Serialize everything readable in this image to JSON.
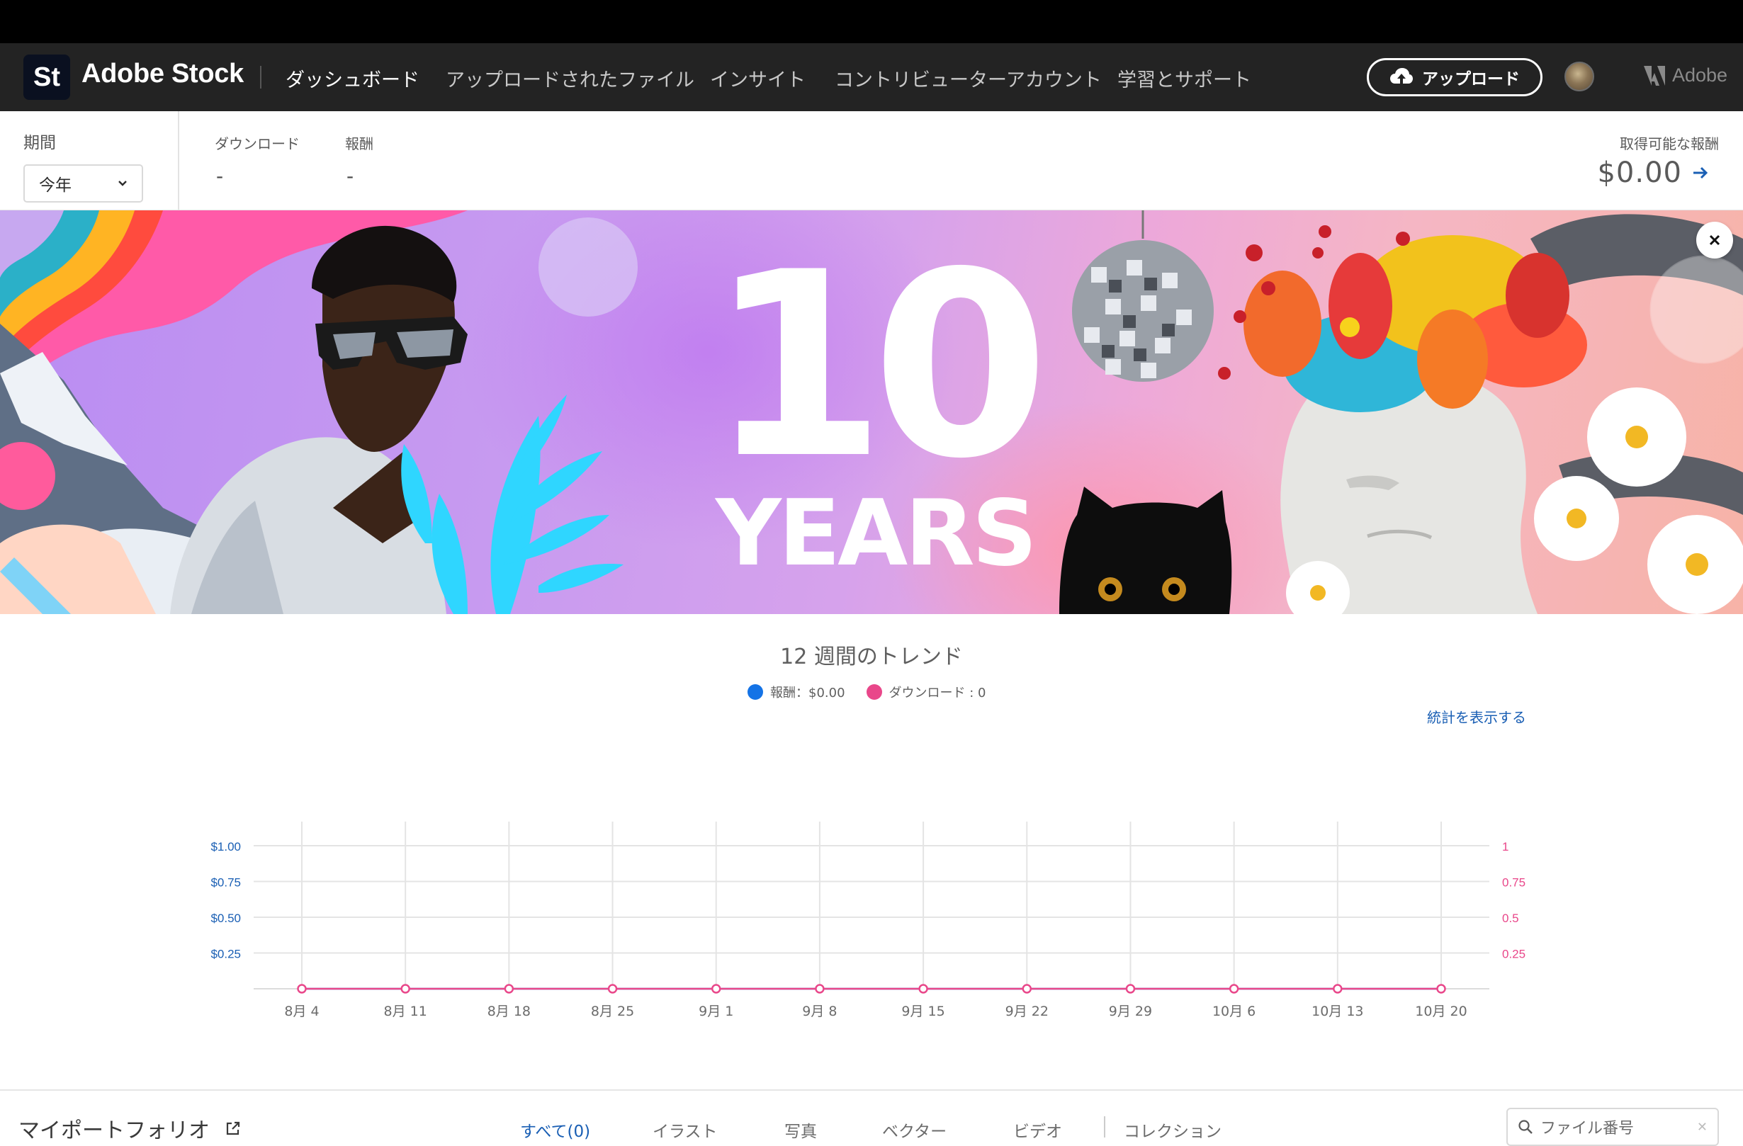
{
  "header": {
    "logo_text": "St",
    "brand": "Adobe Stock",
    "nav": [
      {
        "label": "ダッシュボード",
        "active": true
      },
      {
        "label": "アップロードされたファイル",
        "active": false
      },
      {
        "label": "インサイト",
        "active": false
      },
      {
        "label": "コントリビューターアカウント",
        "active": false
      },
      {
        "label": "学習とサポート",
        "active": false
      }
    ],
    "upload_label": "アップロード",
    "adobe_label": "Adobe"
  },
  "stats": {
    "period_label": "期間",
    "period_value": "今年",
    "downloads_label": "ダウンロード",
    "downloads_value": "-",
    "earnings_label": "報酬",
    "earnings_value": "-",
    "available_label": "取得可能な報酬",
    "available_value": "$0.00"
  },
  "banner": {
    "number": "10",
    "word": "YEARS"
  },
  "trend": {
    "title": "12 週間のトレンド",
    "legend_earnings": "報酬：$0.00",
    "legend_downloads": "ダウンロード : 0",
    "view_stats": "統計を表示する"
  },
  "chart_data": {
    "type": "line",
    "x": [
      "8月 4",
      "8月 11",
      "8月 18",
      "8月 25",
      "9月 1",
      "9月 8",
      "9月 15",
      "9月 22",
      "9月 29",
      "10月 6",
      "10月 13",
      "10月 20"
    ],
    "series": [
      {
        "name": "報酬",
        "axis": "left",
        "values": [
          0,
          0,
          0,
          0,
          0,
          0,
          0,
          0,
          0,
          0,
          0,
          0
        ],
        "color": "#1473e6"
      },
      {
        "name": "ダウンロード",
        "axis": "right",
        "values": [
          0,
          0,
          0,
          0,
          0,
          0,
          0,
          0,
          0,
          0,
          0,
          0
        ],
        "color": "#e9478a"
      }
    ],
    "left_ticks": [
      "$0.25",
      "$0.50",
      "$0.75",
      "$1.00"
    ],
    "right_ticks": [
      "0.25",
      "0.5",
      "0.75",
      "1"
    ],
    "ylim": [
      0,
      1
    ],
    "grid": true
  },
  "portfolio": {
    "title": "マイポートフォリオ",
    "tabs": [
      {
        "label": "すべて(0)",
        "active": true
      },
      {
        "label": "イラスト",
        "active": false
      },
      {
        "label": "写真",
        "active": false
      },
      {
        "label": "ベクター",
        "active": false
      },
      {
        "label": "ビデオ",
        "active": false
      },
      {
        "label": "コレクション",
        "active": false
      }
    ],
    "search_placeholder": "ファイル番号"
  },
  "colors": {
    "header_bg": "#232323",
    "accent_blue": "#1a5fb4",
    "downloads_pink": "#e9478a",
    "earnings_blue": "#1473e6"
  }
}
